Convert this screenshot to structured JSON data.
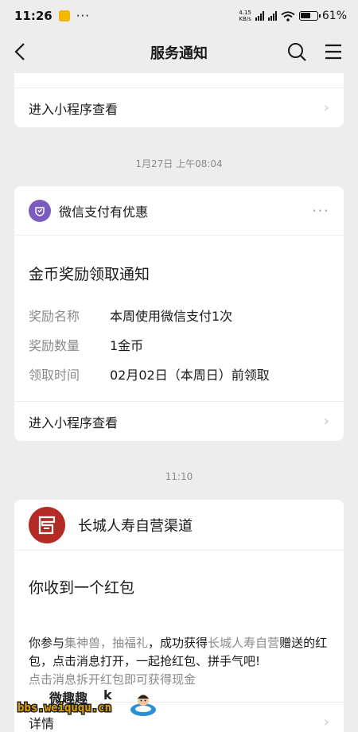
{
  "status_bar": {
    "time": "11:26",
    "more": "···",
    "net_speed": "4.15",
    "net_unit": "KB/s",
    "battery_pct": "61%"
  },
  "nav": {
    "title": "服务通知"
  },
  "card_top": {
    "footer_label": "进入小程序查看"
  },
  "time_1": "1月27日 上午08:04",
  "card_wechat": {
    "source": "微信支付有优惠",
    "more": "···",
    "title": "金币奖励领取通知",
    "fields": [
      {
        "label": "奖励名称",
        "value": "本周使用微信支付1次"
      },
      {
        "label": "奖励数量",
        "value": "1金币"
      },
      {
        "label": "领取时间",
        "value": "02月02日（本周日）前领取"
      }
    ],
    "footer_label": "进入小程序查看"
  },
  "time_2": "11:10",
  "card_insurance": {
    "source": "长城人寿自营渠道",
    "title": "你收到一个红包",
    "body_prefix": "你参与",
    "body_event": "集神兽，抽福礼",
    "body_mid": "，成功获得",
    "body_brand": "长城人寿自营",
    "body_suffix": "赠送的红包，点击消息打开，一起抢红包、拼手气吧!",
    "sub_text": "点击消息拆开红包即可获得现金",
    "detail_label": "详情"
  },
  "watermark": {
    "cn": "微趣趣",
    "k": "k",
    "url": "bbs.weiququ.cn"
  },
  "colors": {
    "background": "#ededed",
    "card": "#ffffff",
    "wechat_pay_icon": "#7a5bbf",
    "insurance_logo": "#b42a24"
  }
}
